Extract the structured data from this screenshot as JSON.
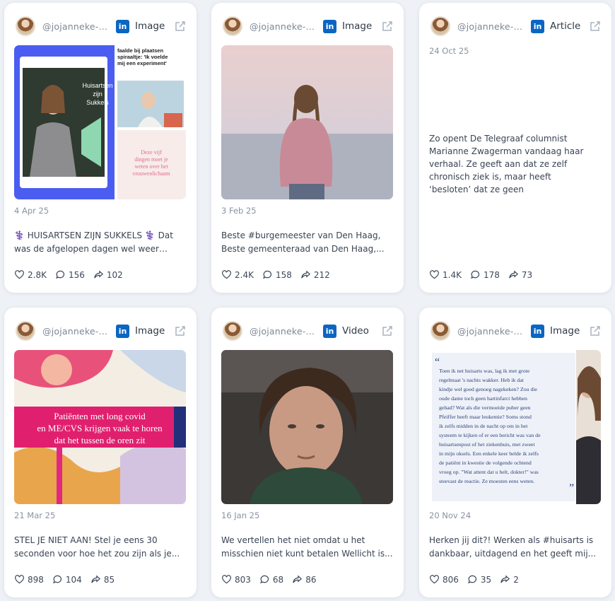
{
  "cards": [
    {
      "handle": "@jojanneke-k...",
      "type": "Image",
      "date": "4 Apr 25",
      "text": "⚕️ HUISARTSEN ZIJN SUKKELS ⚕️ Dat was de afgelopen dagen wel weer duidelijk...",
      "likes": "2.8K",
      "comments": "156",
      "shares": "102",
      "media": {
        "headline_lines": [
          "faalde bij plaatsen",
          "spiraaltje: 'Ik voelde",
          "mij een experiment'"
        ],
        "overlay_lines": [
          "Huisartsen",
          "zijn",
          "Sukkels"
        ],
        "quote_lines": [
          "Deze vijf",
          "dingen moet je",
          "weten over het",
          "vrouwenlichaam"
        ]
      }
    },
    {
      "handle": "@jojanneke-k...",
      "type": "Image",
      "date": "3 Feb 25",
      "text": "Beste #burgemeester van Den Haag, Beste gemeenteraad van Den Haag,...",
      "likes": "2.4K",
      "comments": "158",
      "shares": "212"
    },
    {
      "handle": "@jojanneke-k...",
      "type": "Article",
      "date": "24 Oct 25",
      "text": "Zo opent De Telegraaf columnist Marianne Zwagerman vandaag haar verhaal. Ze geeft aan dat ze zelf chronisch ziek is, maar heeft ‘besloten’ dat ze geen",
      "likes": "1.4K",
      "comments": "178",
      "shares": "73"
    },
    {
      "handle": "@jojanneke-k...",
      "type": "Image",
      "date": "21 Mar 25",
      "text": "STEL JE NIET AAN! Stel je eens 30 seconden voor hoe het zou zijn als je...",
      "likes": "898",
      "comments": "104",
      "shares": "85",
      "media": {
        "banner_lines": [
          "Patiënten met long covid",
          "en ME/CVS krijgen vaak te horen",
          "dat het tussen de oren zit"
        ]
      }
    },
    {
      "handle": "@jojanneke-ka...",
      "type": "Video",
      "date": "16 Jan 25",
      "text": "We vertellen het niet omdat u het misschien niet kunt betalen Wellicht is...",
      "likes": "803",
      "comments": "68",
      "shares": "86"
    },
    {
      "handle": "@jojanneke-k...",
      "type": "Image",
      "date": "20 Nov 24",
      "text": "Herken jij dit?! Werken als #huisarts is dankbaar, uitdagend en het geeft mij...",
      "likes": "806",
      "comments": "35",
      "shares": "2",
      "media": {
        "quote_lines": [
          "Toen ik net huisarts was, lag ik met grote",
          "regelmaat 's nachts wakker. Heb ik dat",
          "kindje wel goed genoeg nagekeken? Zou die",
          "oude dame toch geen hartinfarct hebben",
          "gehad? Wat als die vermoeide puber geen",
          "Pfeiffer heeft maar leukemie? Soms stond",
          "ik zelfs midden in de nacht op om in het",
          "systeem te kijken of er een bericht was van de",
          "huisartsenpost of het ziekenhuis, met zweet",
          "in mijn oksels. Een enkele keer belde ik zelfs",
          "de patiënt in kwestie de volgende ochtend",
          "vroeg op. \"Wat attent dat u belt, dokter!\" was",
          "steevast de reactie. Ze moesten eens weten."
        ]
      }
    }
  ],
  "colors": {
    "linkedin": "#0a66c2",
    "card_bg": "#ffffff",
    "page_bg": "#eef1f6"
  },
  "icons": {
    "network": "linkedin-icon",
    "open": "external-link-icon",
    "like": "heart-icon",
    "comment": "comment-icon",
    "share": "share-icon"
  }
}
